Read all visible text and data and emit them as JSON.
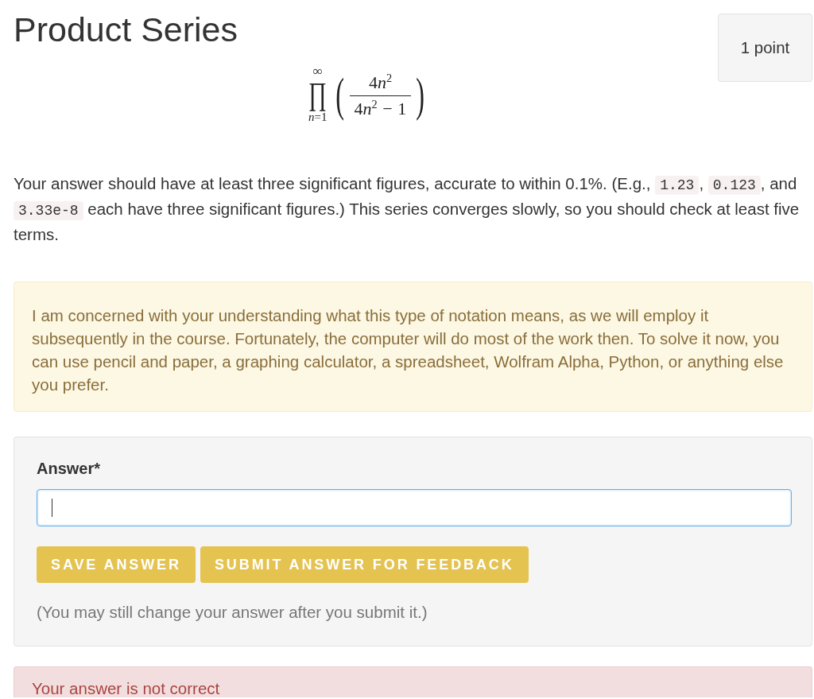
{
  "header": {
    "title": "Product Series",
    "points": "1 point"
  },
  "formula": {
    "operator": "∏",
    "upper": "∞",
    "lower": "*n*=1",
    "left_bracket": "(",
    "numerator": [
      {
        "kind": "number",
        "text": "4"
      },
      {
        "kind": "variable",
        "text": "n"
      },
      {
        "kind": "power",
        "text": "2"
      }
    ],
    "denominator": [
      {
        "kind": "number",
        "text": "4"
      },
      {
        "kind": "variable",
        "text": "n"
      },
      {
        "kind": "power",
        "text": "2"
      },
      {
        "kind": "operator",
        "text": "−"
      },
      {
        "kind": "number",
        "text": "1"
      }
    ],
    "right_bracket": ")"
  },
  "instructions": [
    {
      "kind": "text",
      "text": "Your answer should have at least three significant figures, accurate to within 0.1%. (E.g., "
    },
    {
      "kind": "code",
      "text": "1.23"
    },
    {
      "kind": "text",
      "text": ", "
    },
    {
      "kind": "code",
      "text": "0.123"
    },
    {
      "kind": "text",
      "text": ", and "
    },
    {
      "kind": "code",
      "text": "3.33e-8"
    },
    {
      "kind": "text",
      "text": " each have three significant figures.) This series converges slowly, so you should check at least five terms."
    }
  ],
  "notice": {
    "kind": "warning",
    "text": "I am concerned with your understanding what this type of notation means, as we will employ it subsequently in the course. Fortunately, the computer will do most of the work then. To solve it now, you can use pencil and paper, a graphing calculator, a spreadsheet, Wolfram Alpha, Python, or anything else you prefer."
  },
  "answer_panel": {
    "label": "Answer*",
    "input": {
      "focused": true
    },
    "buttons": [
      {
        "label": "SAVE ANSWER"
      },
      {
        "label": "SUBMIT ANSWER FOR FEEDBACK"
      }
    ],
    "note": "(You may still change your answer after you submit it.)"
  },
  "feedback": {
    "kind": "error",
    "text": "Your answer is not correct"
  }
}
